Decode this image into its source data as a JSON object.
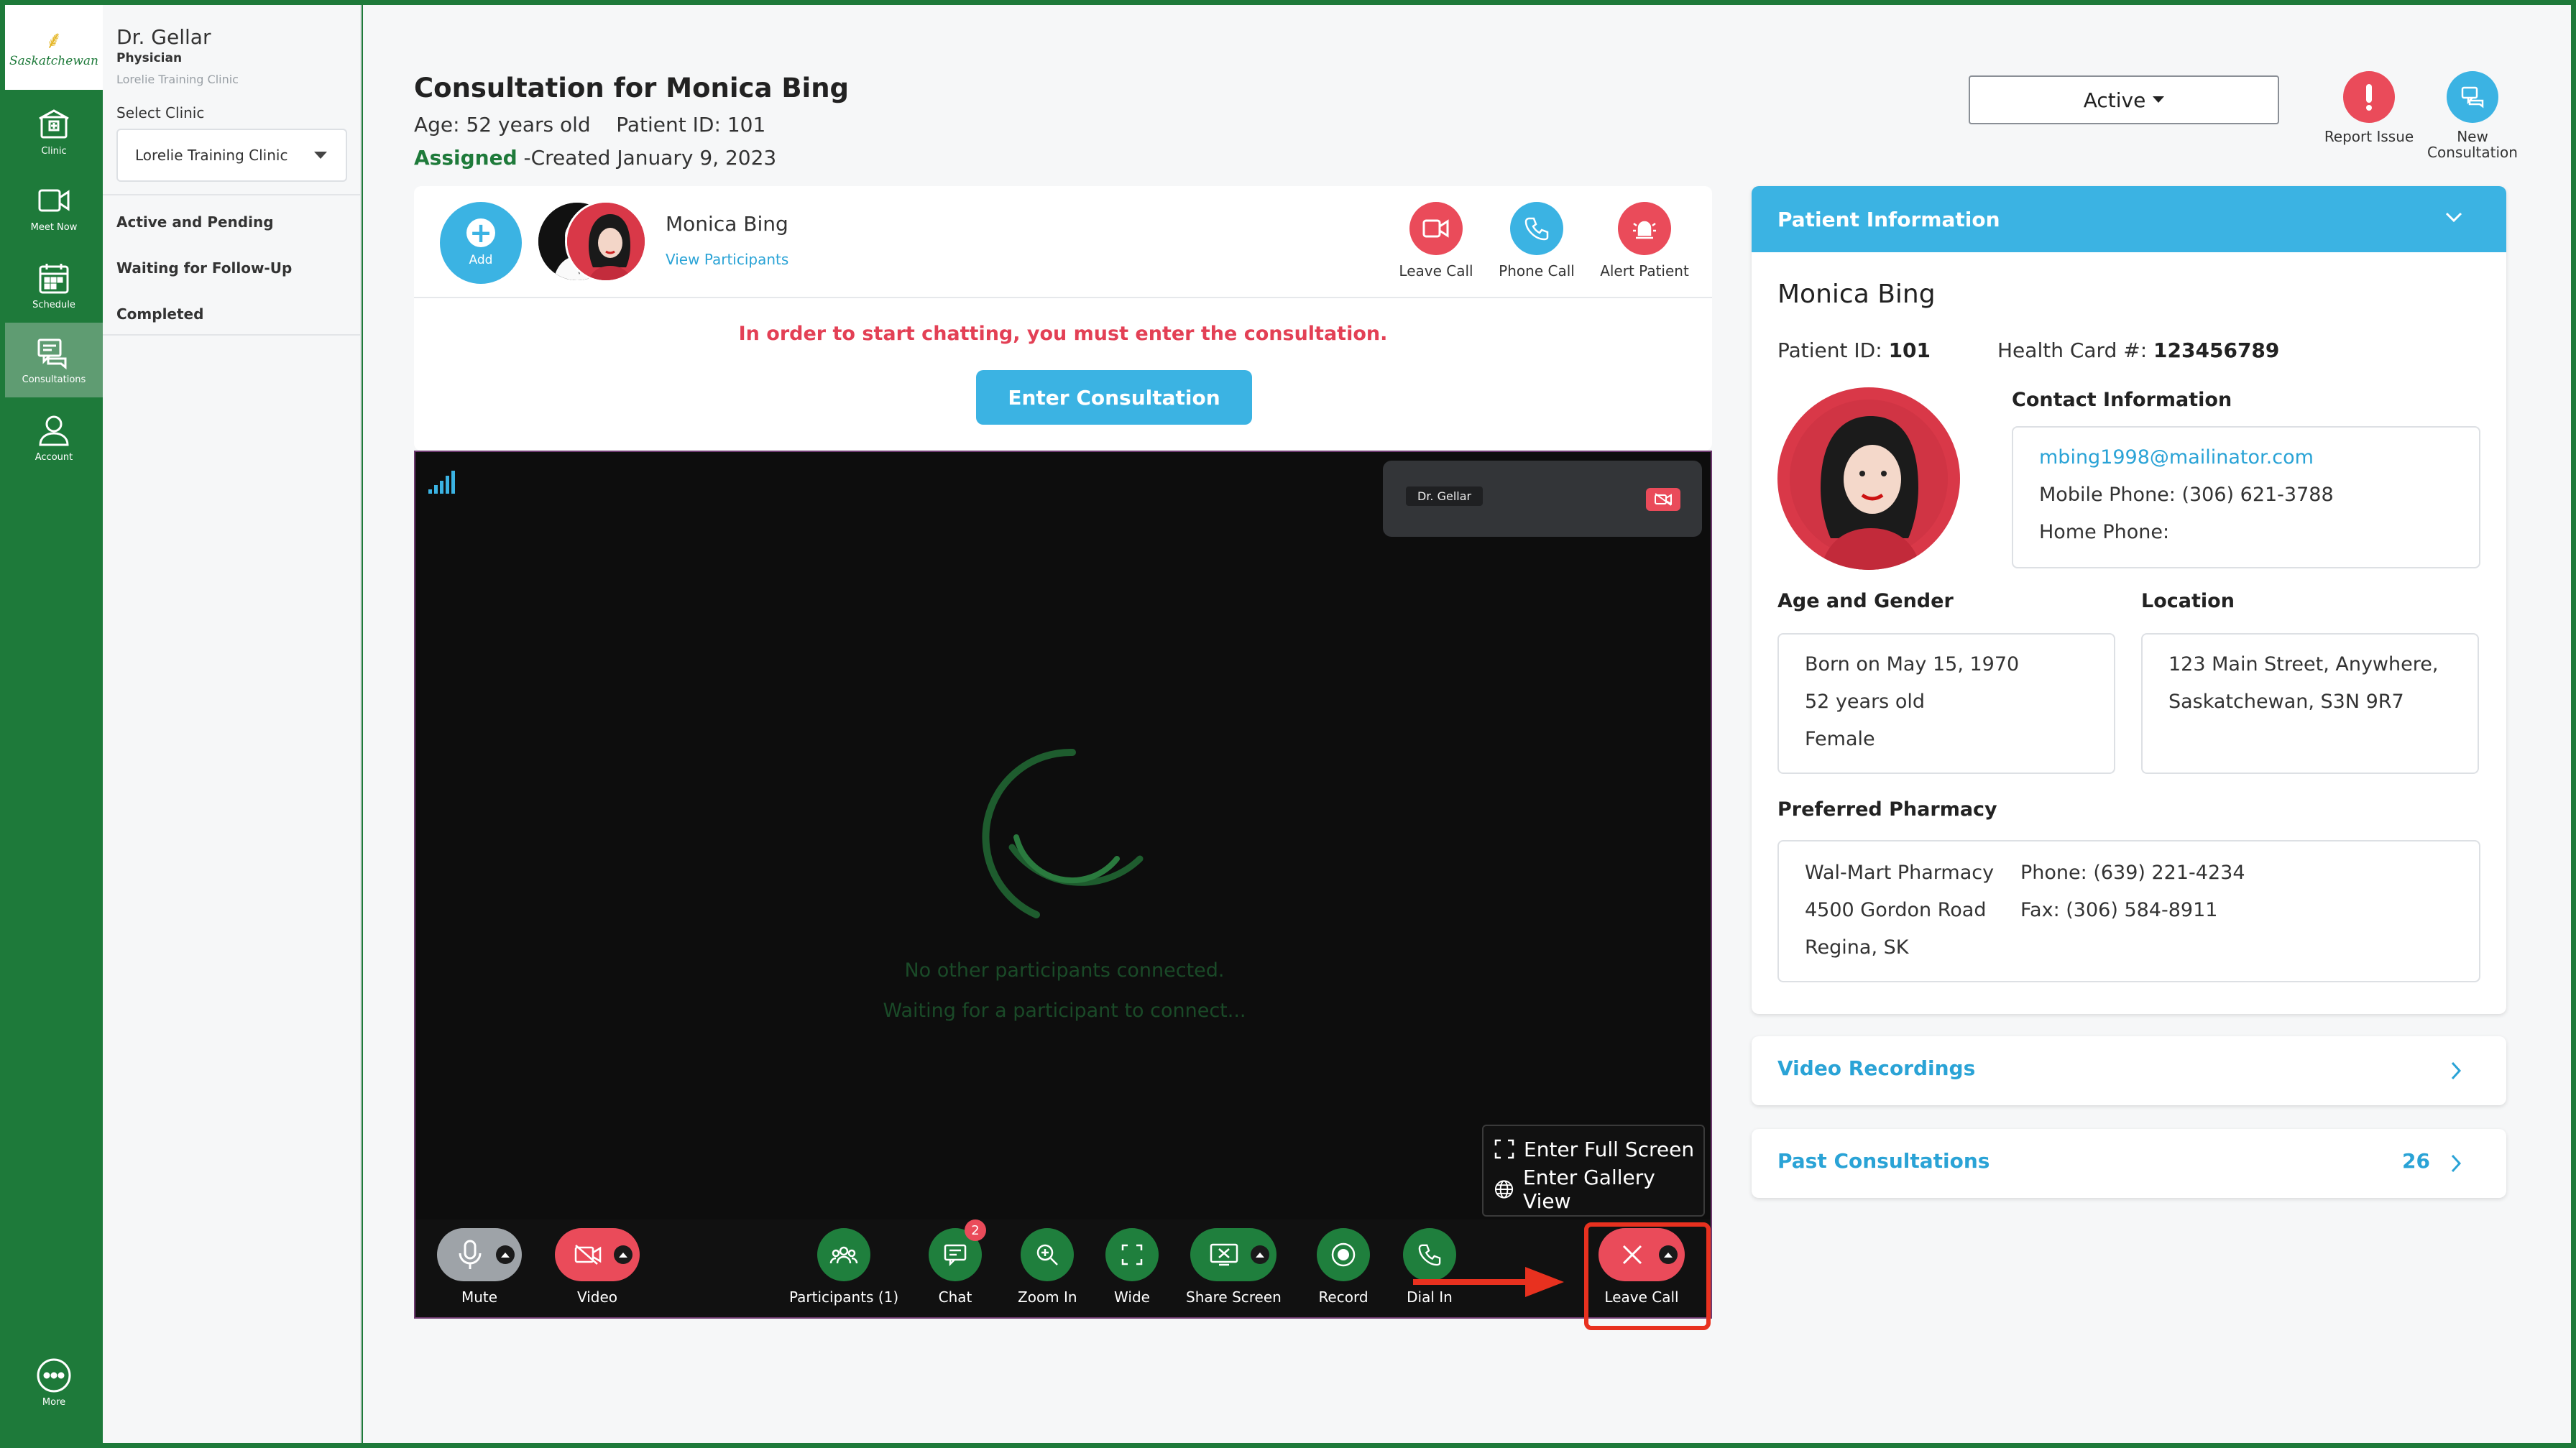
{
  "brand": {
    "logo_text": "Saskatchewan",
    "primary": "#1e7a3a",
    "accent": "#3bb3e3",
    "danger": "#ea4b5a"
  },
  "rail": {
    "items": [
      {
        "label": "Clinic",
        "icon": "clinic-icon"
      },
      {
        "label": "Meet Now",
        "icon": "video-camera-icon"
      },
      {
        "label": "Schedule",
        "icon": "calendar-icon"
      },
      {
        "label": "Consultations",
        "icon": "chat-icon",
        "active": true
      },
      {
        "label": "Account",
        "icon": "user-icon"
      }
    ],
    "more_label": "More"
  },
  "sidebar": {
    "doctor_name": "Dr. Gellar",
    "doctor_role": "Physician",
    "doctor_clinic": "Lorelie Training Clinic",
    "select_label": "Select Clinic",
    "selected_clinic": "Lorelie Training Clinic",
    "nav": [
      "Active and Pending",
      "Waiting for Follow-Up",
      "Completed"
    ]
  },
  "header": {
    "title": "Consultation for Monica Bing",
    "age_line": "Age: 52 years old",
    "patient_id_line": "Patient ID: 101",
    "status_word": "Assigned",
    "created_line": " -Created January 9, 2023",
    "status_select": "Active",
    "report_issue": "Report Issue",
    "new_consultation_l1": "New",
    "new_consultation_l2": "Consultation"
  },
  "consultation": {
    "add_label": "Add",
    "patient_name": "Monica Bing",
    "view_participants": "View Participants",
    "actions": [
      {
        "label": "Leave Call",
        "icon": "video-call-icon"
      },
      {
        "label": "Phone Call",
        "icon": "phone-icon"
      },
      {
        "label": "Alert Patient",
        "icon": "alarm-icon"
      }
    ],
    "warning": "In order to start chatting, you must enter the consultation.",
    "enter_button": "Enter Consultation"
  },
  "video": {
    "self_name": "Dr. Gellar",
    "waiting_line1": "No other participants connected.",
    "waiting_line2": "Waiting for a participant to connect...",
    "menu": [
      "Enter Full Screen",
      "Enter Gallery View"
    ],
    "toolbar": {
      "mute": "Mute",
      "video": "Video",
      "participants": "Participants (1)",
      "chat": "Chat",
      "chat_badge": "2",
      "zoom_in": "Zoom In",
      "wide": "Wide",
      "share_screen": "Share Screen",
      "record": "Record",
      "dial_in": "Dial In",
      "leave_call": "Leave Call"
    }
  },
  "patient_info": {
    "header": "Patient Information",
    "name": "Monica Bing",
    "patient_id_label": "Patient ID:",
    "patient_id": "101",
    "health_card_label": "Health Card #:",
    "health_card": "123456789",
    "contact_heading": "Contact Information",
    "email": "mbing1998@mailinator.com",
    "mobile": "Mobile Phone: (306) 621-3788",
    "home": "Home Phone:",
    "age_gender_heading": "Age and Gender",
    "born": "Born on May 15, 1970",
    "age": "52 years old",
    "gender": "Female",
    "location_heading": "Location",
    "address1": "123 Main Street, Anywhere,",
    "address2": "Saskatchewan, S3N 9R7",
    "pharmacy_heading": "Preferred Pharmacy",
    "pharmacy_name": "Wal-Mart Pharmacy",
    "pharmacy_street": "4500 Gordon Road",
    "pharmacy_city": "Regina, SK",
    "pharmacy_phone": "Phone: (639) 221-4234",
    "pharmacy_fax": "Fax: (306) 584-8911"
  },
  "accordions": {
    "video_recordings": "Video Recordings",
    "past_consultations": "Past Consultations",
    "past_count": "26"
  }
}
